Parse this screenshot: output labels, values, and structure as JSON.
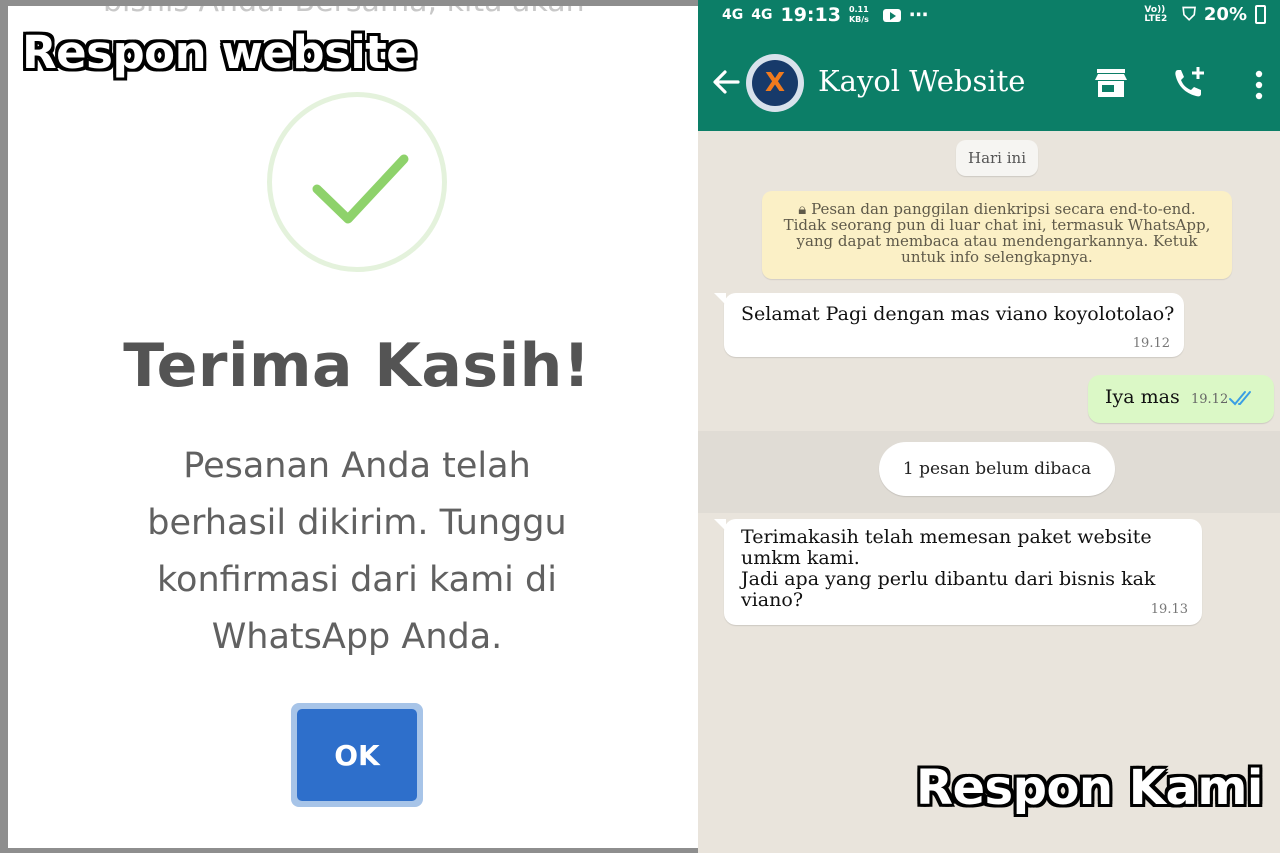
{
  "left_panel": {
    "background_text": "bisnis Anda. Bersama, kita akan",
    "overlay_label": "Respon website",
    "dialog": {
      "title": "Terima Kasih!",
      "message_lines": [
        "Pesanan Anda telah",
        "berhasil dikirim. Tunggu",
        "konfirmasi dari kami di",
        "WhatsApp Anda."
      ],
      "ok_label": "OK",
      "check_color": "#8ed26b",
      "ok_color": "#2e6fcb"
    }
  },
  "right_panel": {
    "overlay_label": "Respon Kami",
    "status_bar": {
      "network1": "4G",
      "network2": "4G",
      "time": "19:13",
      "speed": "0.11 KB/s",
      "volte": "Vo)) LTE2",
      "battery": "20%"
    },
    "app_bar": {
      "contact_name": "Kayol Website",
      "avatar_letter": "X",
      "icons": [
        "back-arrow-icon",
        "store-icon",
        "add-call-icon",
        "more-vert-icon"
      ],
      "color": "#0c7e67"
    },
    "chat": {
      "date_chip": "Hari ini",
      "encryption_notice": "Pesan dan panggilan dienkripsi secara end-to-end. Tidak seorang pun di luar chat ini, termasuk WhatsApp, yang dapat membaca atau mendengarkannya. Ketuk untuk info selengkapnya.",
      "messages": [
        {
          "direction": "in",
          "text": "Selamat Pagi dengan mas viano koyolotolao?",
          "time": "19.12"
        },
        {
          "direction": "out",
          "text": "Iya mas",
          "time": "19.12",
          "status": "read"
        },
        {
          "direction": "in",
          "text_lines": [
            "Terimakasih telah memesan paket website",
            "umkm kami.",
            "Jadi apa yang perlu dibantu dari bisnis kak",
            "viano?"
          ],
          "time": "19.13"
        }
      ],
      "unread_chip": "1 pesan belum dibaca"
    }
  }
}
